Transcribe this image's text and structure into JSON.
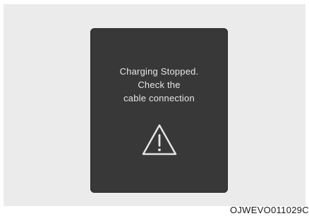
{
  "message": {
    "line1": "Charging Stopped.",
    "line2": "Check the",
    "line3": "cable connection"
  },
  "icon": "warning-triangle-icon",
  "caption": "OJWEVO011029C",
  "colors": {
    "background": "#ebebeb",
    "panel": "#383838",
    "text": "#e6e6e6"
  }
}
